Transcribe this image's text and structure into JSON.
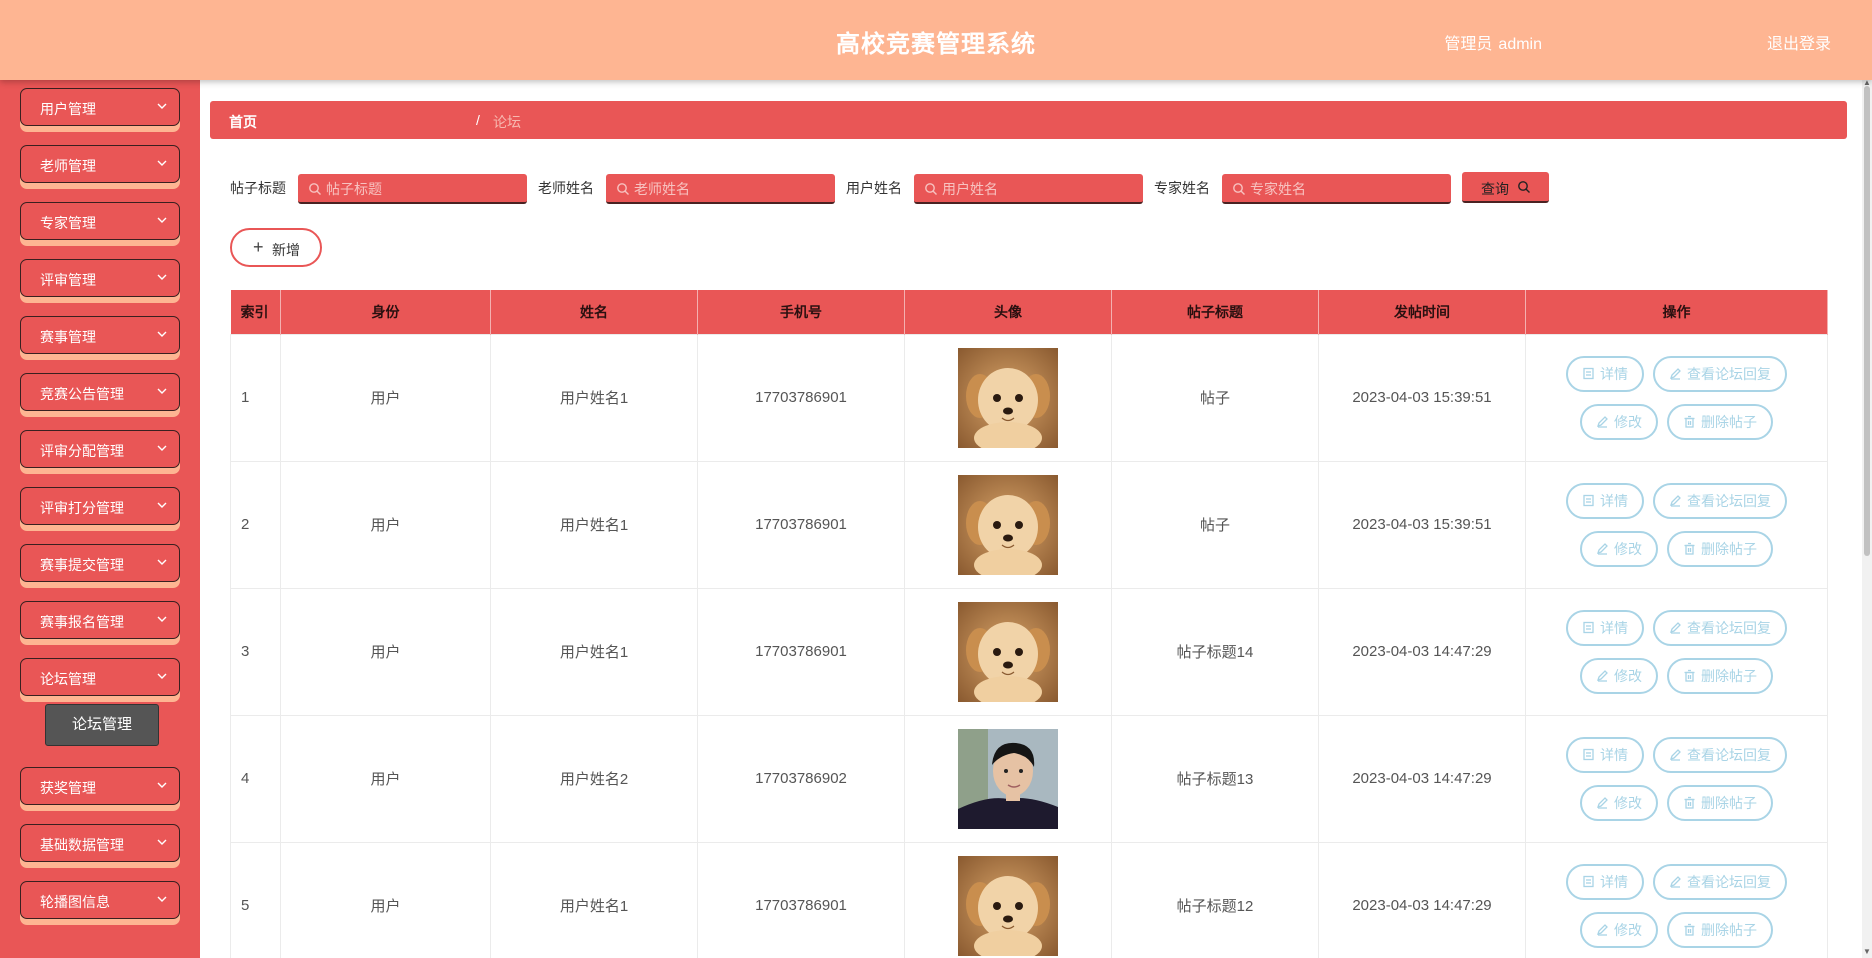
{
  "header": {
    "title": "高校竞赛管理系统",
    "user_role": "管理员",
    "username": "admin",
    "logout_label": "退出登录"
  },
  "sidebar": {
    "items": [
      {
        "label": "用户管理"
      },
      {
        "label": "老师管理"
      },
      {
        "label": "专家管理"
      },
      {
        "label": "评审管理"
      },
      {
        "label": "赛事管理"
      },
      {
        "label": "竞赛公告管理"
      },
      {
        "label": "评审分配管理"
      },
      {
        "label": "评审打分管理"
      },
      {
        "label": "赛事提交管理"
      },
      {
        "label": "赛事报名管理"
      },
      {
        "label": "论坛管理"
      },
      {
        "label": "获奖管理"
      },
      {
        "label": "基础数据管理"
      },
      {
        "label": "轮播图信息"
      }
    ],
    "active_submenu": "论坛管理"
  },
  "breadcrumb": {
    "home": "首页",
    "separator": "/",
    "current": "论坛"
  },
  "search": {
    "fields": [
      {
        "label": "帖子标题",
        "placeholder": "帖子标题"
      },
      {
        "label": "老师姓名",
        "placeholder": "老师姓名"
      },
      {
        "label": "用户姓名",
        "placeholder": "用户姓名"
      },
      {
        "label": "专家姓名",
        "placeholder": "专家姓名"
      }
    ],
    "query_label": "查询"
  },
  "add_button": {
    "label": "新增"
  },
  "table": {
    "headers": [
      "索引",
      "身份",
      "姓名",
      "手机号",
      "头像",
      "帖子标题",
      "发帖时间",
      "操作"
    ],
    "rows": [
      {
        "index": "1",
        "role": "用户",
        "name": "用户姓名1",
        "phone": "17703786901",
        "avatar": "puppy",
        "title": "帖子",
        "time": "2023-04-03 15:39:51"
      },
      {
        "index": "2",
        "role": "用户",
        "name": "用户姓名1",
        "phone": "17703786901",
        "avatar": "puppy",
        "title": "帖子",
        "time": "2023-04-03 15:39:51"
      },
      {
        "index": "3",
        "role": "用户",
        "name": "用户姓名1",
        "phone": "17703786901",
        "avatar": "puppy",
        "title": "帖子标题14",
        "time": "2023-04-03 14:47:29"
      },
      {
        "index": "4",
        "role": "用户",
        "name": "用户姓名2",
        "phone": "17703786902",
        "avatar": "man",
        "title": "帖子标题13",
        "time": "2023-04-03 14:47:29"
      },
      {
        "index": "5",
        "role": "用户",
        "name": "用户姓名1",
        "phone": "17703786901",
        "avatar": "puppy",
        "title": "帖子标题12",
        "time": "2023-04-03 14:47:29"
      }
    ],
    "actions": {
      "detail": "详情",
      "view_replies": "查看论坛回复",
      "edit": "修改",
      "delete": "删除帖子"
    }
  },
  "colors": {
    "header_bg": "#feb592",
    "sidebar_bg": "#e95656",
    "accent": "#e95656",
    "action_border": "#a9d4e6"
  }
}
